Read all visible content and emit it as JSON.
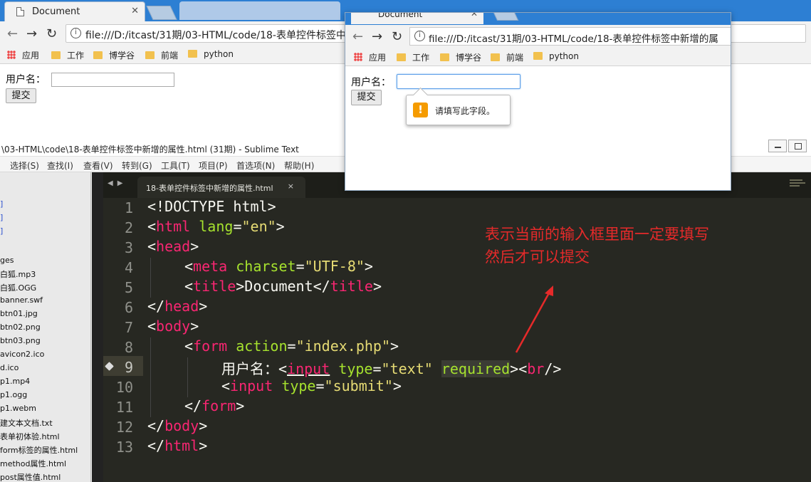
{
  "background_browser": {
    "tab_title": "Document",
    "url": "file:///D:/itcast/31期/03-HTML/code/18-表单控件标签中新增的属性.html",
    "bookmarks": [
      "应用",
      "工作",
      "博学谷",
      "前端",
      "python"
    ],
    "form": {
      "label": "用户名：",
      "submit": "提交",
      "input_value": ""
    }
  },
  "foreground_browser": {
    "tab_title": "Document",
    "url": "file:///D:/itcast/31期/03-HTML/code/18-表单控件标签中新增的属",
    "bookmarks": [
      "应用",
      "工作",
      "博学谷",
      "前端",
      "python"
    ],
    "form": {
      "label": "用户名：",
      "submit": "提交",
      "input_value": ""
    },
    "validation_tooltip": "请填写此字段。",
    "warning_glyph": "!"
  },
  "sublime": {
    "window_title": "\\03-HTML\\code\\18-表单控件标签中新增的属性.html (31期) - Sublime Text",
    "menu": [
      "选择(S)",
      "查找(I)",
      "查看(V)",
      "转到(G)",
      "工具(T)",
      "项目(P)",
      "首选项(N)",
      "帮助(H)"
    ],
    "tab_name": "18-表单控件标签中新增的属性.html",
    "tab_close": "×",
    "sidebar_files": [
      "]",
      "]",
      "]",
      "ges",
      "白狐.mp3",
      "白狐.OGG",
      "banner.swf",
      "btn01.jpg",
      "btn02.png",
      "btn03.png",
      "avicon2.ico",
      "d.ico",
      "p1.mp4",
      "p1.ogg",
      "p1.webm",
      "建文本文档.txt",
      "表单初体验.html",
      "form标签的属性.html",
      "method属性.html",
      "post属性值.html"
    ],
    "line_numbers": [
      "1",
      "2",
      "3",
      "4",
      "5",
      "6",
      "7",
      "8",
      "9",
      "10",
      "11",
      "12",
      "13"
    ],
    "code": {
      "l1": {
        "a": "<!DOCTYPE html>"
      },
      "l2": {
        "a": "<",
        "b": "html",
        "c": " ",
        "d": "lang",
        "e": "=",
        "f": "\"en\"",
        "g": ">"
      },
      "l3": {
        "a": "<",
        "b": "head",
        "c": ">"
      },
      "l4": {
        "a": "<",
        "b": "meta",
        "c": " ",
        "d": "charset",
        "e": "=",
        "f": "\"UTF-8\"",
        "g": ">"
      },
      "l5": {
        "a": "<",
        "b": "title",
        "c": ">Document</",
        "d": "title",
        "e": ">"
      },
      "l6": {
        "a": "</",
        "b": "head",
        "c": ">"
      },
      "l7": {
        "a": "<",
        "b": "body",
        "c": ">"
      },
      "l8": {
        "a": "<",
        "b": "form",
        "c": " ",
        "d": "action",
        "e": "=",
        "f": "\"index.php\"",
        "g": ">"
      },
      "l9": {
        "a": "用户名：<",
        "b": "input",
        "c": " ",
        "d": "type",
        "e": "=",
        "f": "\"text\"",
        "g": " ",
        "h": "required",
        "i": "><",
        "j": "br",
        "k": "/>"
      },
      "l10": {
        "a": "<",
        "b": "input",
        "c": " ",
        "d": "type",
        "e": "=",
        "f": "\"submit\"",
        "g": ">"
      },
      "l11": {
        "a": "</",
        "b": "form",
        "c": ">"
      },
      "l12": {
        "a": "</",
        "b": "body",
        "c": ">"
      },
      "l13": {
        "a": "</",
        "b": "html",
        "c": ">"
      }
    }
  },
  "annotation": {
    "line1": "表示当前的输入框里面一定要填写",
    "line2": "然后才可以提交",
    "color": "#e52a2a"
  },
  "colors": {
    "tag": "#f92672",
    "attr": "#a6e22e",
    "string": "#e6db74",
    "editor_bg": "#272822",
    "tab_strip": "#2d7fd3"
  }
}
